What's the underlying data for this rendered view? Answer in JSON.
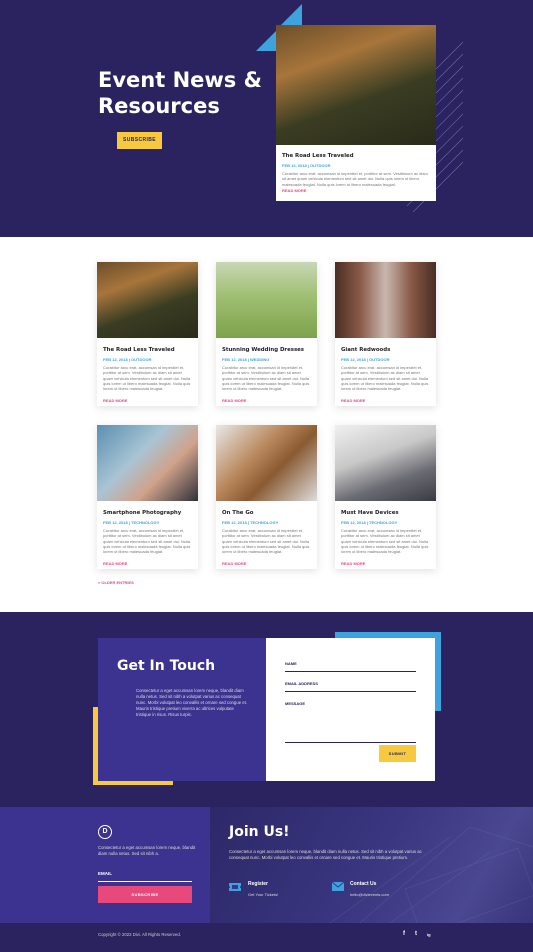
{
  "hero": {
    "title": "Event News & Resources",
    "subscribe": "SUBSCRIBE",
    "featured": {
      "title": "The Road Less Traveled",
      "meta": "FEB 12, 2018 | OUTDOOR",
      "excerpt": "Curabitur arcu erat, accumsan id imperdiet et, porttitor at sem. Vestibulum ac diam sit amet quam vehicula elementum sed sit amet dui. Nulla quis lorem ut libero malesuada feugiat. Nulla quis lorem ut libero malesuada feugiat.",
      "more": "READ MORE"
    }
  },
  "posts": [
    {
      "title": "The Road Less Traveled",
      "meta": "FEB 12, 2018 | OUTDOOR",
      "excerpt": "Curabitur arcu erat, accumsan id imperdiet et, porttitor at sem. Vestibulum ac diam sit amet quam vehicula elementum sed sit amet dui. Nulla quis lorem ut libero malesuada feugiat. Nulla quis lorem ut libero malesuada feugiat.",
      "more": "READ MORE",
      "photo": "forest path"
    },
    {
      "title": "Stunning Wedding Dresses",
      "meta": "FEB 12, 2018 | WEDDING",
      "excerpt": "Curabitur arcu erat, accumsan id imperdiet et, porttitor at sem. Vestibulum ac diam sit amet quam vehicula elementum sed sit amet dui. Nulla quis lorem ut libero malesuada feugiat. Nulla quis lorem ut libero malesuada feugiat.",
      "more": "READ MORE",
      "photo": "bride in field"
    },
    {
      "title": "Giant Redwoods",
      "meta": "FEB 12, 2018 | OUTDOOR",
      "excerpt": "Curabitur arcu erat, accumsan id imperdiet et, porttitor at sem. Vestibulum ac diam sit amet quam vehicula elementum sed sit amet dui. Nulla quis lorem ut libero malesuada feugiat. Nulla quis lorem ut libero malesuada feugiat.",
      "more": "READ MORE",
      "photo": "redwood forest"
    },
    {
      "title": "Smartphone Photography",
      "meta": "FEB 12, 2018 | TECHNOLOGY",
      "excerpt": "Curabitur arcu erat, accumsan id imperdiet et, porttitor at sem. Vestibulum ac diam sit amet quam vehicula elementum sed sit amet dui. Nulla quis lorem ut libero malesuada feugiat. Nulla quis lorem ut libero malesuada feugiat.",
      "more": "READ MORE",
      "photo": "hands with camera"
    },
    {
      "title": "On The Go",
      "meta": "FEB 12, 2018 | TECHNOLOGY",
      "excerpt": "Curabitur arcu erat, accumsan id imperdiet et, porttitor at sem. Vestibulum ac diam sit amet quam vehicula elementum sed sit amet dui. Nulla quis lorem ut libero malesuada feugiat. Nulla quis lorem ut libero malesuada feugiat.",
      "more": "READ MORE",
      "photo": "phone on leather case"
    },
    {
      "title": "Must Have Devices",
      "meta": "FEB 12, 2018 | TECHNOLOGY",
      "excerpt": "Curabitur arcu erat, accumsan id imperdiet et, porttitor at sem. Vestibulum ac diam sit amet quam vehicula elementum sed sit amet dui. Nulla quis lorem ut libero malesuada feugiat. Nulla quis lorem ut libero malesuada feugiat.",
      "more": "READ MORE",
      "photo": "laptop keyboard"
    }
  ],
  "older_entries": "« OLDER ENTRIES",
  "contact": {
    "title": "Get In Touch",
    "text": "Consectetur a eget accumsan lorem neque, blandit diam nulla netus. Sed sit nibh a volutpat varius ac consequat nunc. Morbi volutpat leo convallis et ornare sed congue et. Mauris tristique pretium viverra ac ultrices vulputate tristique in risus. Risus turpis.",
    "name_label": "NAME",
    "email_label": "EMAIL ADDRESS",
    "message_label": "MESSAGE",
    "submit": "SUBMIT"
  },
  "footer": {
    "logo": "D",
    "text": "Consectetur a eget accumsan lorem neque, blandit diam nulla netus. Sed sit nibh a.",
    "email_label": "EMAIL",
    "subscribe": "SUBSCRIBE",
    "join_title": "Join Us!",
    "join_text": "Consectetur a eget accumsan lorem neque, blandit diam nulla netus. Sed sit nibh a volutpat varius ac consequat nunc. Morbi volutpat leo convallis et ornare sed congue et. Mauris tristique pretium.",
    "register_title": "Register",
    "register_sub": "Get Your Tickets!",
    "contact_title": "Contact Us",
    "contact_sub": "hello@divievents.com",
    "copyright": "Copyright © 2022 Divi. All Rights Reserved.",
    "social": [
      "f",
      "t",
      "ig"
    ]
  },
  "colors": {
    "navy": "#2a2360",
    "purple": "#3b338f",
    "yellow": "#f7c93f",
    "blue": "#3ea3dc",
    "pink": "#e6497a"
  }
}
